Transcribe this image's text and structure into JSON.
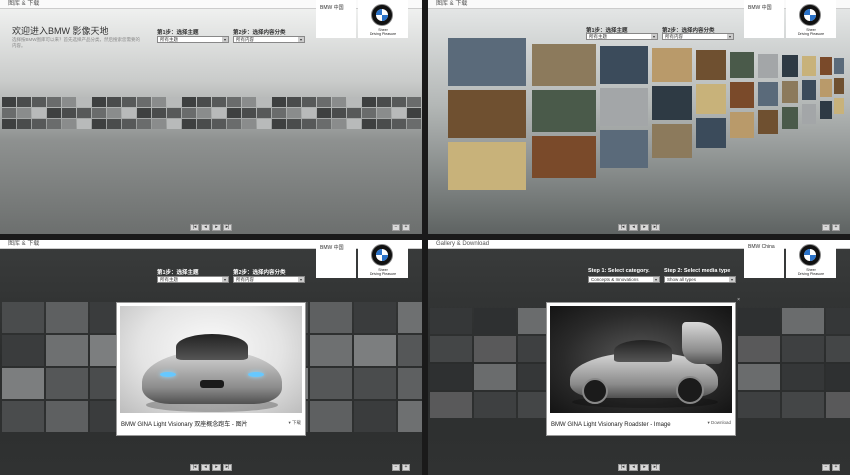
{
  "panel_zh": {
    "breadcrumb": "图库 & 下载",
    "country": "BMW 中国",
    "logo_tagline": "Sheer\nDriving Pleasure",
    "welcome_title": "欢迎进入BMW 影像天地",
    "welcome_sub": "选择按BMW图库可以来？首先选择产品分类，然后搜索您需要的内容。",
    "step1_label": "第1步：选择主题",
    "step1_value": "所有主题",
    "step2_label": "第2步：选择内容分类",
    "step2_value": "所有内容",
    "caption": "BMW GINA Light Visionary 双座概念跑车 - 图片",
    "download": "▾ 下载"
  },
  "panel_en": {
    "breadcrumb": "Gallery & Download",
    "country": "BMW China",
    "logo_tagline": "Sheer\nDriving Pleasure",
    "step1_label": "Step 1: Select category.",
    "step1_value": "Concepts & Innovations",
    "step2_label": "Step 2: Select media type",
    "step2_value": "Show all types",
    "caption": "BMW GINA Light Visionary Roadster - Image",
    "download": "▾ Download",
    "close": "×"
  },
  "pager": {
    "first": "|◂",
    "prev": "◂",
    "next": "▸",
    "last": "▸|"
  },
  "zoom": {
    "out": "−",
    "in": "+"
  },
  "colors": {
    "bmw_blue": "#2b73c9",
    "headlight": "#66c8ff"
  }
}
